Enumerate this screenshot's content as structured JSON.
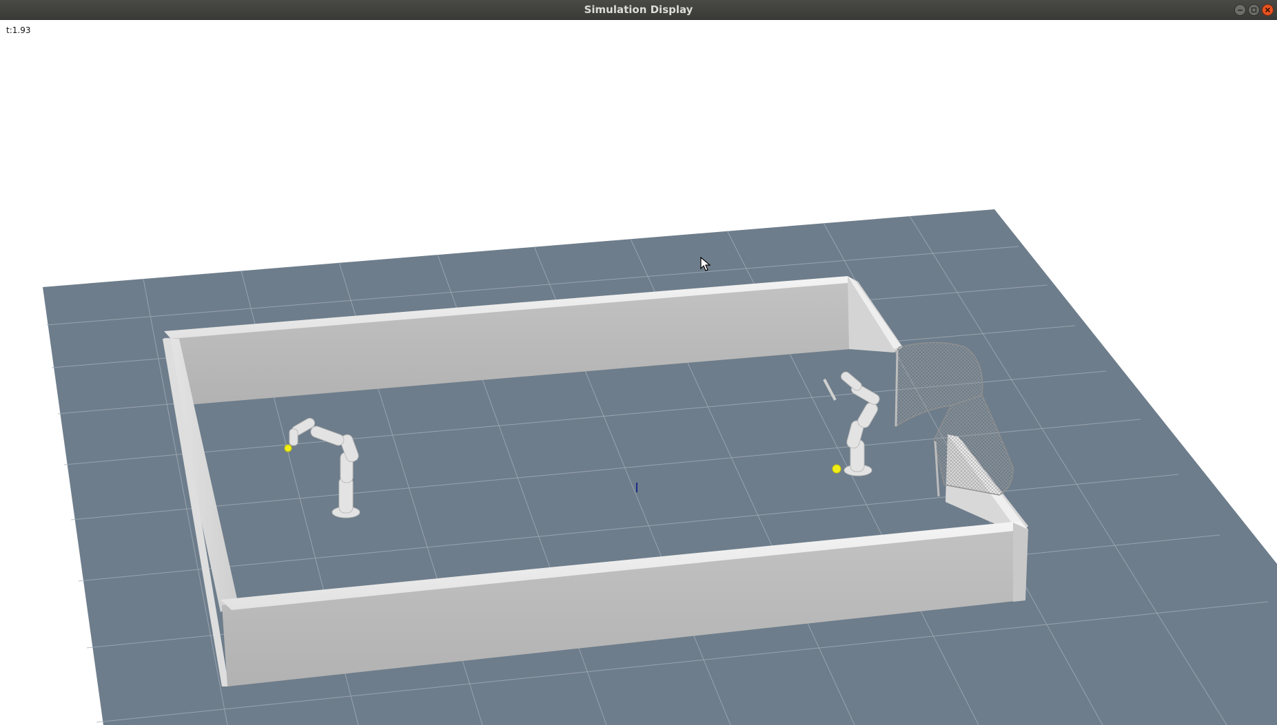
{
  "window": {
    "title": "Simulation Display"
  },
  "overlay": {
    "time_label": "t:1.93"
  },
  "scene": {
    "floor_color": "#6e7d8b",
    "grid_color": "#a9b4be",
    "wall_color": "#b9b9b9",
    "ball_color": "#f2ee19",
    "objects": [
      "arena-floor",
      "arena-walls",
      "robot-arm-left",
      "robot-arm-right",
      "goal-net",
      "ball-left",
      "ball-right"
    ]
  }
}
